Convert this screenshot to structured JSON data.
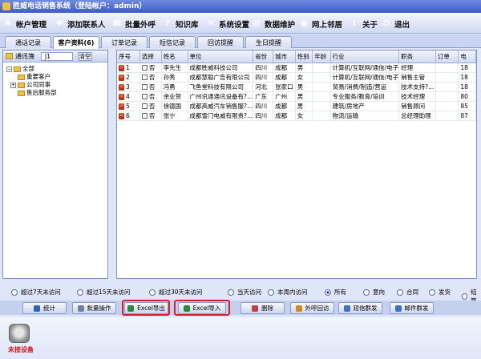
{
  "window": {
    "title": "胜威电话销售系统（登陆帐户：admin）"
  },
  "toolbar": [
    {
      "label": "帐户管理",
      "icon": "account-icon",
      "color": "#2f6fd0"
    },
    {
      "label": "添加联系人",
      "icon": "add-contact-icon",
      "color": "#3a9a3a"
    },
    {
      "label": "批量外呼",
      "icon": "batch-call-icon",
      "color": "#d08a20"
    },
    {
      "label": "知识库",
      "icon": "knowledge-icon",
      "color": "#c03030"
    },
    {
      "label": "系统设置",
      "icon": "settings-icon",
      "color": "#777777"
    },
    {
      "label": "数据维护",
      "icon": "data-icon",
      "color": "#3060b0"
    },
    {
      "label": "网上邻居",
      "icon": "network-icon",
      "color": "#2a9a4a"
    },
    {
      "label": "关于",
      "icon": "about-icon",
      "color": "#3050c0"
    },
    {
      "label": "退出",
      "icon": "exit-icon",
      "color": "#2060c8"
    }
  ],
  "tabs": [
    "通话记录",
    "客户资料(6)",
    "订单记录",
    "短信记录",
    "回访提醒",
    "生日提醒"
  ],
  "active_tab": 1,
  "sidebar": {
    "title": "通讯簿",
    "search_value": "J1",
    "clear_label": "清空",
    "tree": {
      "root": "全部",
      "children": [
        "重要客户",
        "公司同事",
        "售后服务部"
      ]
    }
  },
  "table": {
    "columns": [
      "序号",
      "选择",
      "姓名",
      "单位",
      "省份",
      "城市",
      "性别",
      "年龄",
      "行业",
      "职务",
      "订单",
      "电"
    ],
    "rows": [
      [
        "1",
        "否",
        "李先生",
        "成都胜威科技公司",
        "四川",
        "成都",
        "男",
        "",
        "计算机/互联网/通信/电子",
        "经理",
        "",
        "18"
      ],
      [
        "2",
        "否",
        "孙秀",
        "成都慧聪广告有限公司",
        "四川",
        "成都",
        "女",
        "",
        "计算机/互联网/通信/电子",
        "销售主管",
        "",
        "18"
      ],
      [
        "3",
        "否",
        "冯勇",
        "飞鱼堂科技有限公司",
        "河北",
        "张家口",
        "男",
        "",
        "贸易/消费/制造/营运",
        "技术支持?...",
        "",
        "18"
      ],
      [
        "4",
        "否",
        "余业贺",
        "广州讯通通讯设备有?...",
        "广东",
        "广州",
        "男",
        "",
        "专业服务/教育/培训",
        "技术经理",
        "",
        "80"
      ],
      [
        "5",
        "否",
        "徐德国",
        "成都高威汽车销售服?...",
        "四川",
        "成都",
        "男",
        "",
        "建筑/房地产",
        "销售顾问",
        "",
        "85"
      ],
      [
        "6",
        "否",
        "张宁",
        "成都雪门电威有限责?...",
        "四川",
        "成都",
        "女",
        "",
        "物流/运输",
        "总经理助理",
        "",
        "87"
      ]
    ]
  },
  "filters": {
    "options": [
      "超过7天未访问",
      "超过15天未访问",
      "超过30天未访问",
      "当天访问",
      "本周内访问",
      "所有",
      "意向",
      "合同",
      "发货",
      "结算"
    ],
    "selected": "所有"
  },
  "actions": [
    "统计",
    "批量操作",
    "Excel导出",
    "Excel导入",
    "删除",
    "外呼回访",
    "短信群发",
    "邮件群发"
  ],
  "status": {
    "device": "未接设备"
  }
}
